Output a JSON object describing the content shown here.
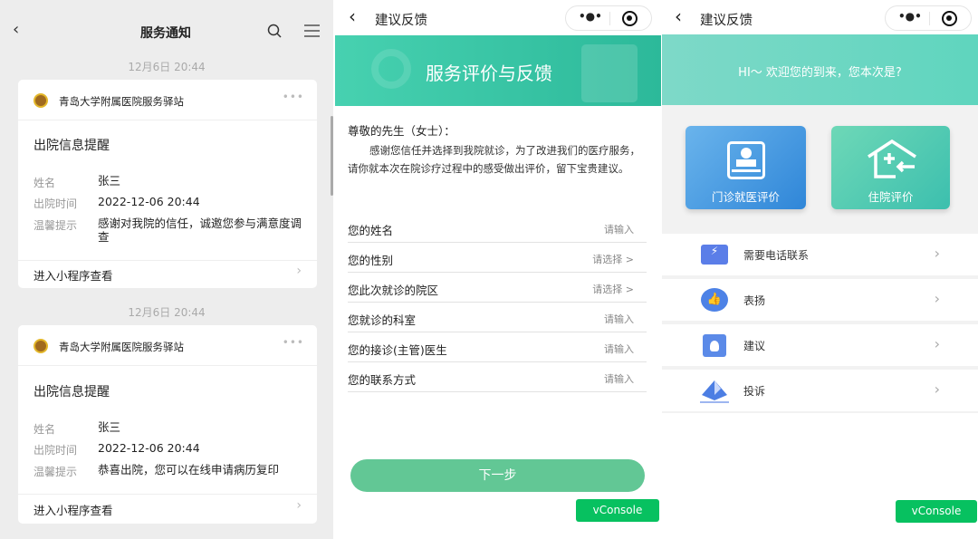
{
  "left": {
    "title": "服务通知",
    "cards": [
      {
        "date": "12月6日 20:44",
        "sender": "青岛大学附属医院服务驿站",
        "title": "出院信息提醒",
        "rows": [
          {
            "label": "姓名",
            "value": "张三"
          },
          {
            "label": "出院时间",
            "value": "2022-12-06 20:44"
          },
          {
            "label": "温馨提示",
            "value": "感谢对我院的信任，诚邀您参与满意度调查"
          }
        ],
        "link": "进入小程序查看"
      },
      {
        "date": "12月6日 20:44",
        "sender": "青岛大学附属医院服务驿站",
        "title": "出院信息提醒",
        "rows": [
          {
            "label": "姓名",
            "value": "张三"
          },
          {
            "label": "出院时间",
            "value": "2022-12-06 20:44"
          },
          {
            "label": "温馨提示",
            "value": "恭喜出院，您可以在线申请病历复印"
          }
        ],
        "link": "进入小程序查看"
      }
    ]
  },
  "middle": {
    "title": "建议反馈",
    "banner": "服务评价与反馈",
    "greeting": "尊敬的先生（女士）：",
    "paragraph": "感谢您信任并选择到我院就诊，为了改进我们的医疗服务，请你就本次在院诊疗过程中的感受做出评价，留下宝贵建议。",
    "fields": [
      {
        "label": "您的姓名",
        "placeholder": "请输入"
      },
      {
        "label": "您的性别",
        "placeholder": "请选择 >"
      },
      {
        "label": "您此次就诊的院区",
        "placeholder": "请选择 >"
      },
      {
        "label": "您就诊的科室",
        "placeholder": "请输入"
      },
      {
        "label": "您的接诊(主管)医生",
        "placeholder": "请输入"
      },
      {
        "label": "您的联系方式",
        "placeholder": "请输入"
      }
    ],
    "next": "下一步",
    "vconsole": "vConsole"
  },
  "right": {
    "title": "建议反馈",
    "banner": "HI～ 欢迎您的到来，您本次是?",
    "outpatient": "门诊就医评价",
    "inpatient": "住院评价",
    "items": [
      {
        "label": "需要电话联系"
      },
      {
        "label": "表扬"
      },
      {
        "label": "建议"
      },
      {
        "label": "投诉"
      }
    ],
    "vconsole": "vConsole"
  }
}
